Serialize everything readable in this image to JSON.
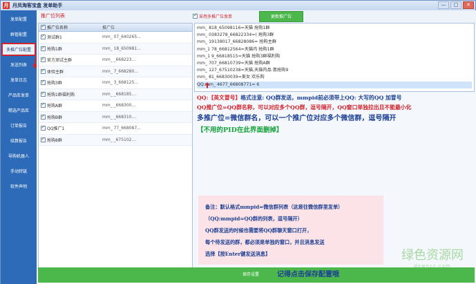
{
  "window": {
    "title": "月凤淘客宝盒 发单助手",
    "controls": [
      "—",
      "□",
      "✕"
    ]
  },
  "sidebar": {
    "items": [
      {
        "label": "发单配置",
        "active": false
      },
      {
        "label": "群管配置",
        "active": false
      },
      {
        "label": "多推广位配置",
        "active": true
      },
      {
        "label": "发送列表",
        "active": false
      },
      {
        "label": "发单日志",
        "active": false
      },
      {
        "label": "产品库发单",
        "active": false
      },
      {
        "label": "精选产品库",
        "active": false
      },
      {
        "label": "订单报告",
        "active": false
      },
      {
        "label": "结算报告",
        "active": false
      },
      {
        "label": "导购机器人",
        "active": false
      },
      {
        "label": "手动转链",
        "active": false
      },
      {
        "label": "软件声明",
        "active": false
      }
    ]
  },
  "top": {
    "list_title": "推广位列表",
    "multi_label": "采用多推广位发单",
    "update_button": "更新推广位"
  },
  "table": {
    "col_name": "推广位名称",
    "col_pos": "推广位",
    "rows": [
      {
        "name": "测试群1",
        "pos": "mm_                     07_640265..."
      },
      {
        "name": "抢购1群",
        "pos": "mm_                     18_650981..."
      },
      {
        "name": "官方测试主群",
        "pos": "mm_                     _668223..."
      },
      {
        "name": "体验主群",
        "pos": "mm_                     7_668280..."
      },
      {
        "name": "抢购3群",
        "pos": "mm_                     3_668125..."
      },
      {
        "name": "抢购1群福利购",
        "pos": "mm_                     _668185..."
      },
      {
        "name": "抢购A群",
        "pos": "mm_                     _668300..."
      },
      {
        "name": "抢购B群",
        "pos": "mm_                     _668310..."
      },
      {
        "name": "QQ推广1",
        "pos": "mm_                     77_668087..."
      },
      {
        "name": "抢购8群",
        "pos": "mm_                     _675102..."
      }
    ]
  },
  "editor": {
    "lines": [
      "mm_                          818_65098116=天猫                 抢购1群",
      "mm_                        0383278_66822334=(                  抢购3群",
      "mm_                   19138017_66828086=                       抢购主群",
      "mm_1                     78_66812564=天猫内                    抢购1群",
      "mm_1                      9_66818515=天猫                      抢购3群福利购",
      "mm_                      707_66810739=天猫                      抢购A群",
      "mm_                      127_67510238=天猫,天猫内品         惠抢购9",
      "mm_                      81_66830039=美女                  欢乐购",
      "QQ:mm_                      4677_66808771=                      6"
    ]
  },
  "notes": {
    "line1_prefix": "QQ:【英文冒号】",
    "line1_rest": "格式注意: QQ群发送，mmpid前必须带上QQ: 大写的QQ 加冒号",
    "line2": "QQ推广位=QQ群名称，可以对应多个QQ群，逗号隔开，QQ窗口单独拉出且不能最小化",
    "line3": "多推广位=微信群名，可以一个推广位对应多个微信群，逗号隔开",
    "line4": "【不用的PID在此界面删掉】"
  },
  "note_box": {
    "lines": [
      "备注：默认格式mmpid=微信群列表（这是往微信群里发单）",
      "（QQ:mmpid=QQ群的列表，逗号隔开）",
      "QQ群发送的时候也需要将QQ群聊天窗口打开，",
      "每个待发送的群，都必须是单独的窗口，并且消息发送",
      "选择【按Enter键发送消息】"
    ]
  },
  "save": {
    "button": "保存设置",
    "hint": "记得点击保存配置哦"
  },
  "watermark": {
    "cn": "绿色资源网",
    "en": "downcc.com"
  },
  "colors": {
    "sidebar": "#2d6bb8",
    "accent_red": "#d2232a",
    "green_bar": "#4cb84c",
    "note_blue": "#1c3f93",
    "note_green": "#17a33b",
    "note_box_bg": "#fbe3e8"
  }
}
